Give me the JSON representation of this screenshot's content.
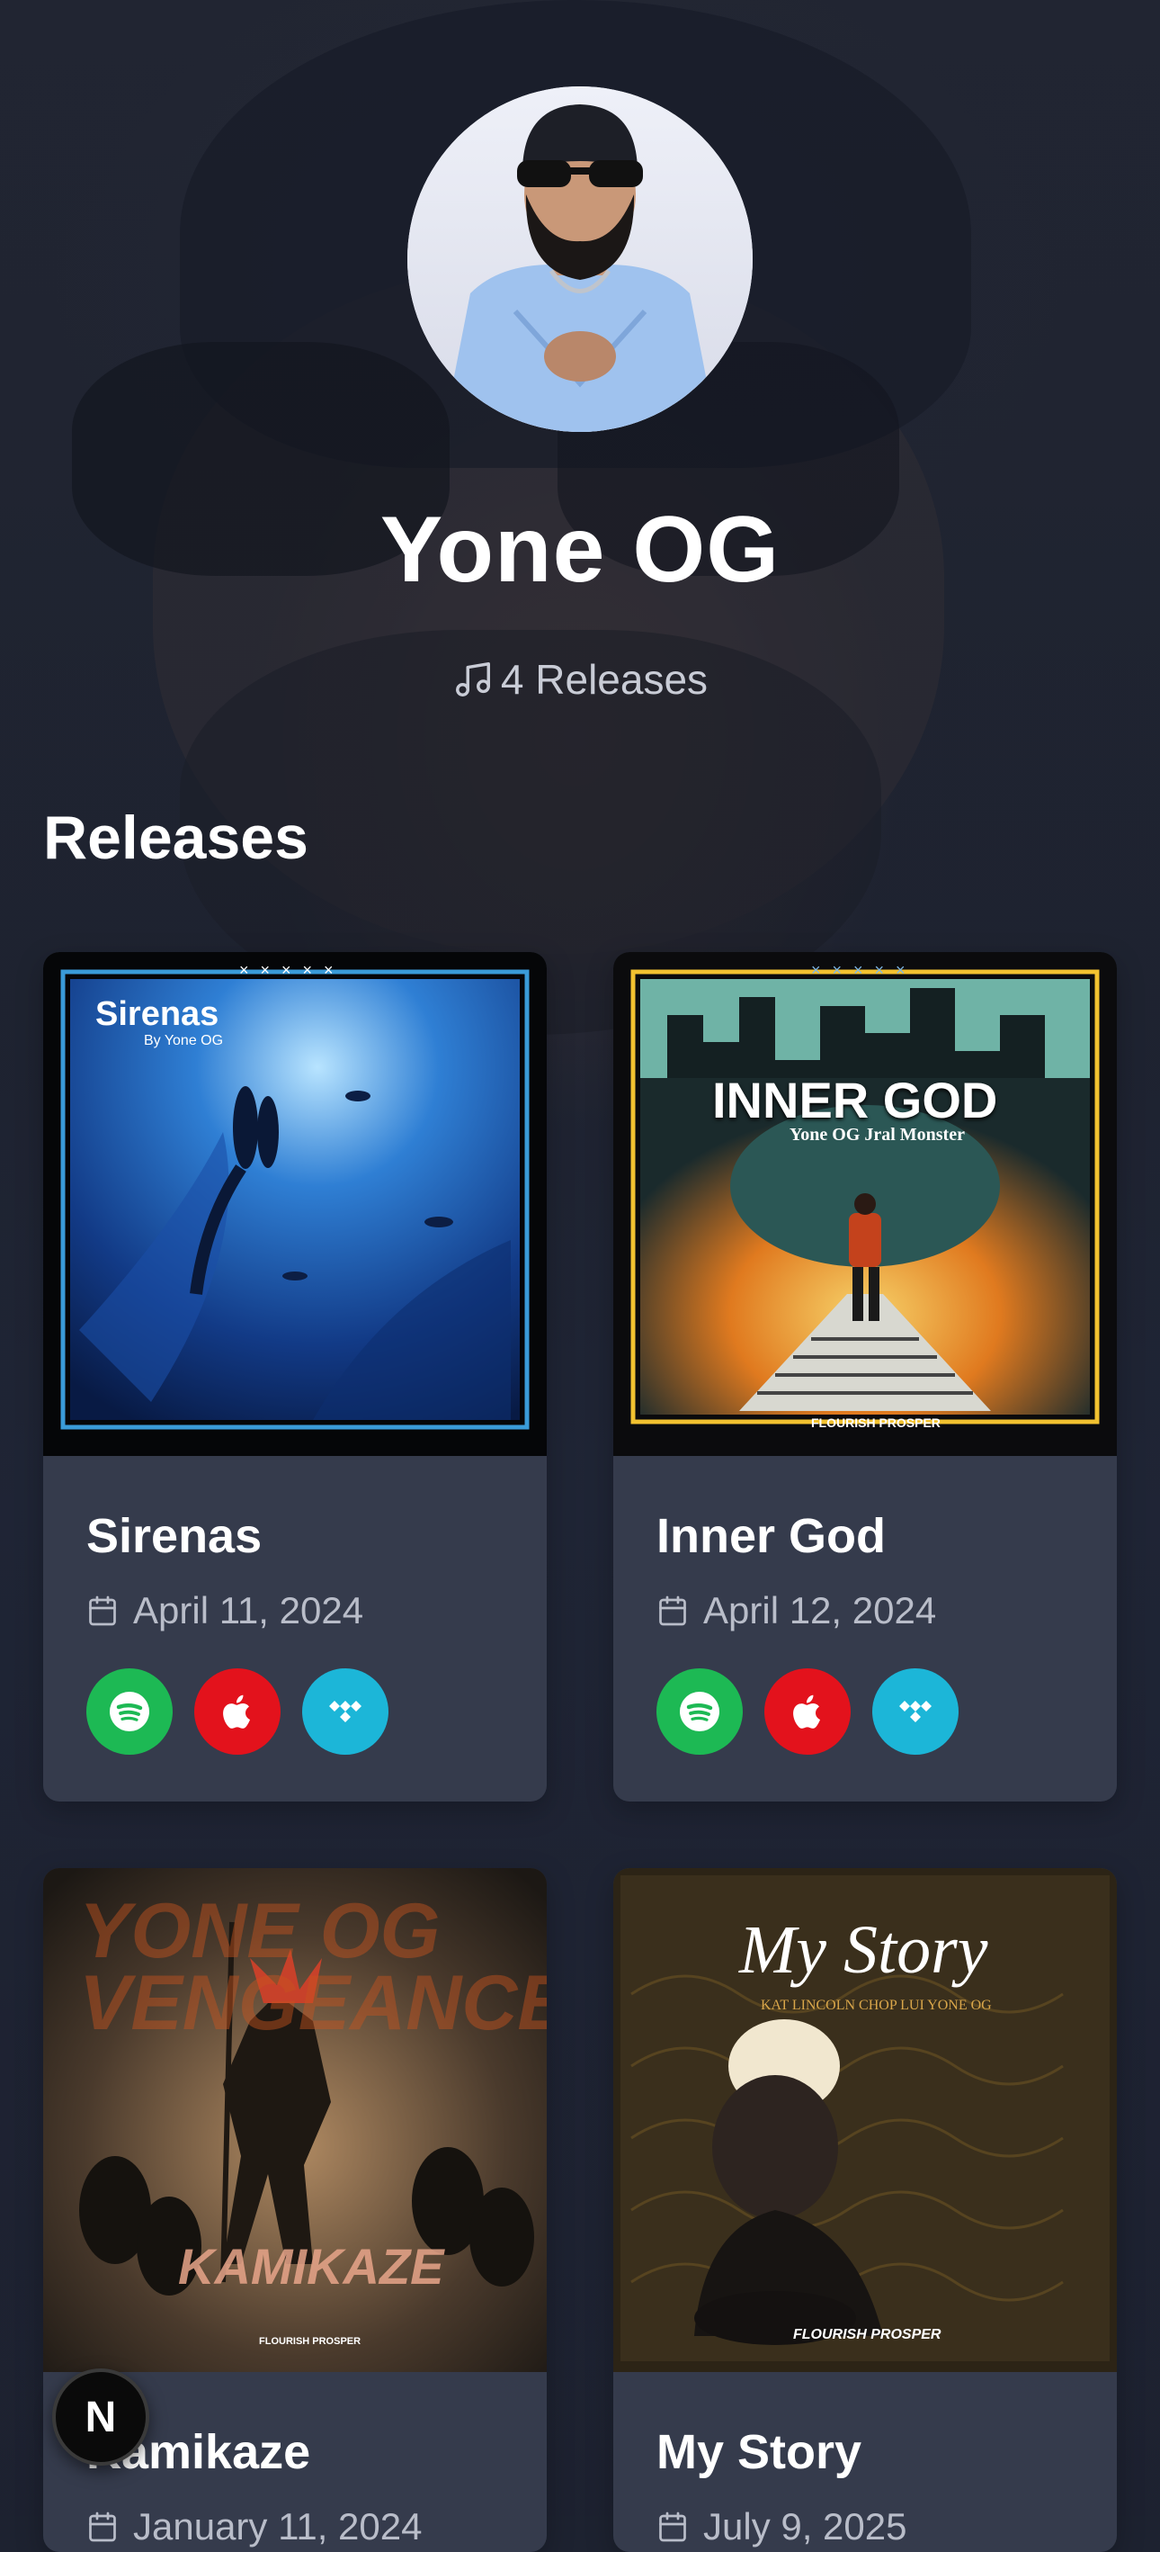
{
  "artist": {
    "name": "Yone OG",
    "release_count_text": "4 Releases"
  },
  "section": {
    "title": "Releases"
  },
  "releases": [
    {
      "title": "Sirenas",
      "date": "April 11, 2024",
      "art_title": "Sirenas",
      "art_subtitle": "By Yone OG",
      "art_marks": "× × × × ×"
    },
    {
      "title": "Inner God",
      "date": "April 12, 2024",
      "art_title": "INNER GOD",
      "art_subtitle": "Yone OG Jral Monster",
      "art_label": "FLOURISH PROSPER",
      "art_marks": "× × × × ×"
    },
    {
      "title": "Kamikaze",
      "date": "January 11, 2024",
      "art_title": "KAMIKAZE",
      "art_bg_text": "YONE OG VENGEANCE",
      "art_label": "FLOURISH PROSPER"
    },
    {
      "title": "My Story",
      "date": "July 9, 2025",
      "art_title": "My Story",
      "art_subtitle": "KAT LINCOLN CHOP LUI YONE OG",
      "art_label": "FLOURISH PROSPER"
    }
  ],
  "platforms": {
    "spotify_icon": "spotify-icon",
    "apple_icon": "apple-music-icon",
    "tidal_icon": "tidal-icon",
    "colors": {
      "spotify": "#1db954",
      "apple": "#e3121c",
      "tidal": "#1cb6d8"
    }
  },
  "dev_badge": {
    "letter": "N"
  }
}
